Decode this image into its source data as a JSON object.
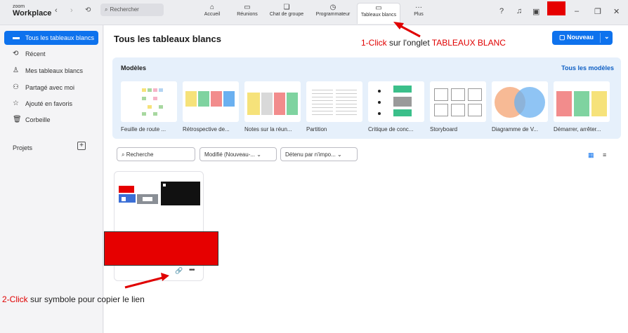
{
  "app": {
    "brand_small": "zoom",
    "brand": "Workplace"
  },
  "topbar": {
    "search_placeholder": "Rechercher",
    "tabs": [
      {
        "label": "Accueil",
        "icon": "home-icon"
      },
      {
        "label": "Réunions",
        "icon": "video-icon"
      },
      {
        "label": "Chat de groupe",
        "icon": "chat-icon"
      },
      {
        "label": "Programmateur",
        "icon": "clock-icon"
      },
      {
        "label": "Tableaux blancs",
        "icon": "whiteboard-icon"
      },
      {
        "label": "Plus",
        "icon": "more-icon"
      }
    ],
    "active_tab": "Tableaux blancs"
  },
  "sidebar": {
    "items": [
      {
        "label": "Tous les tableaux blancs",
        "icon": "whiteboard-icon",
        "active": true
      },
      {
        "label": "Récent",
        "icon": "history-icon"
      },
      {
        "label": "Mes tableaux blancs",
        "icon": "person-icon"
      },
      {
        "label": "Partagé avec moi",
        "icon": "people-icon"
      },
      {
        "label": "Ajouté en favoris",
        "icon": "star-icon"
      },
      {
        "label": "Corbeille",
        "icon": "trash-icon"
      }
    ],
    "projects_label": "Projets",
    "projects_add": "+"
  },
  "main": {
    "title": "Tous les tableaux blancs",
    "new_button": "Nouveau",
    "models": {
      "title": "Modèles",
      "see_all": "Tous les modèles",
      "templates": [
        "Feuille de route ...",
        "Rétrospective de...",
        "Notes sur la réun...",
        "Partition",
        "Critique de conc...",
        "Storyboard",
        "Diagramme de V...",
        "Démarrer, arrêter..."
      ]
    },
    "filters": {
      "search_placeholder": "Recherche",
      "sort": "Modifié (Nouveau-...",
      "owner": "Détenu par n'impo..."
    }
  },
  "annotations": {
    "step1_num": "1-Click",
    "step1_mid": " sur l'onglet ",
    "step1_target": "TABLEAUX BLANC",
    "step2_num": "2-Click",
    "step2_rest": " sur symbole pour copier le lien"
  },
  "colors": {
    "accent": "#0e72ed",
    "annotation_red": "#e00000",
    "redaction": "#e60000"
  }
}
